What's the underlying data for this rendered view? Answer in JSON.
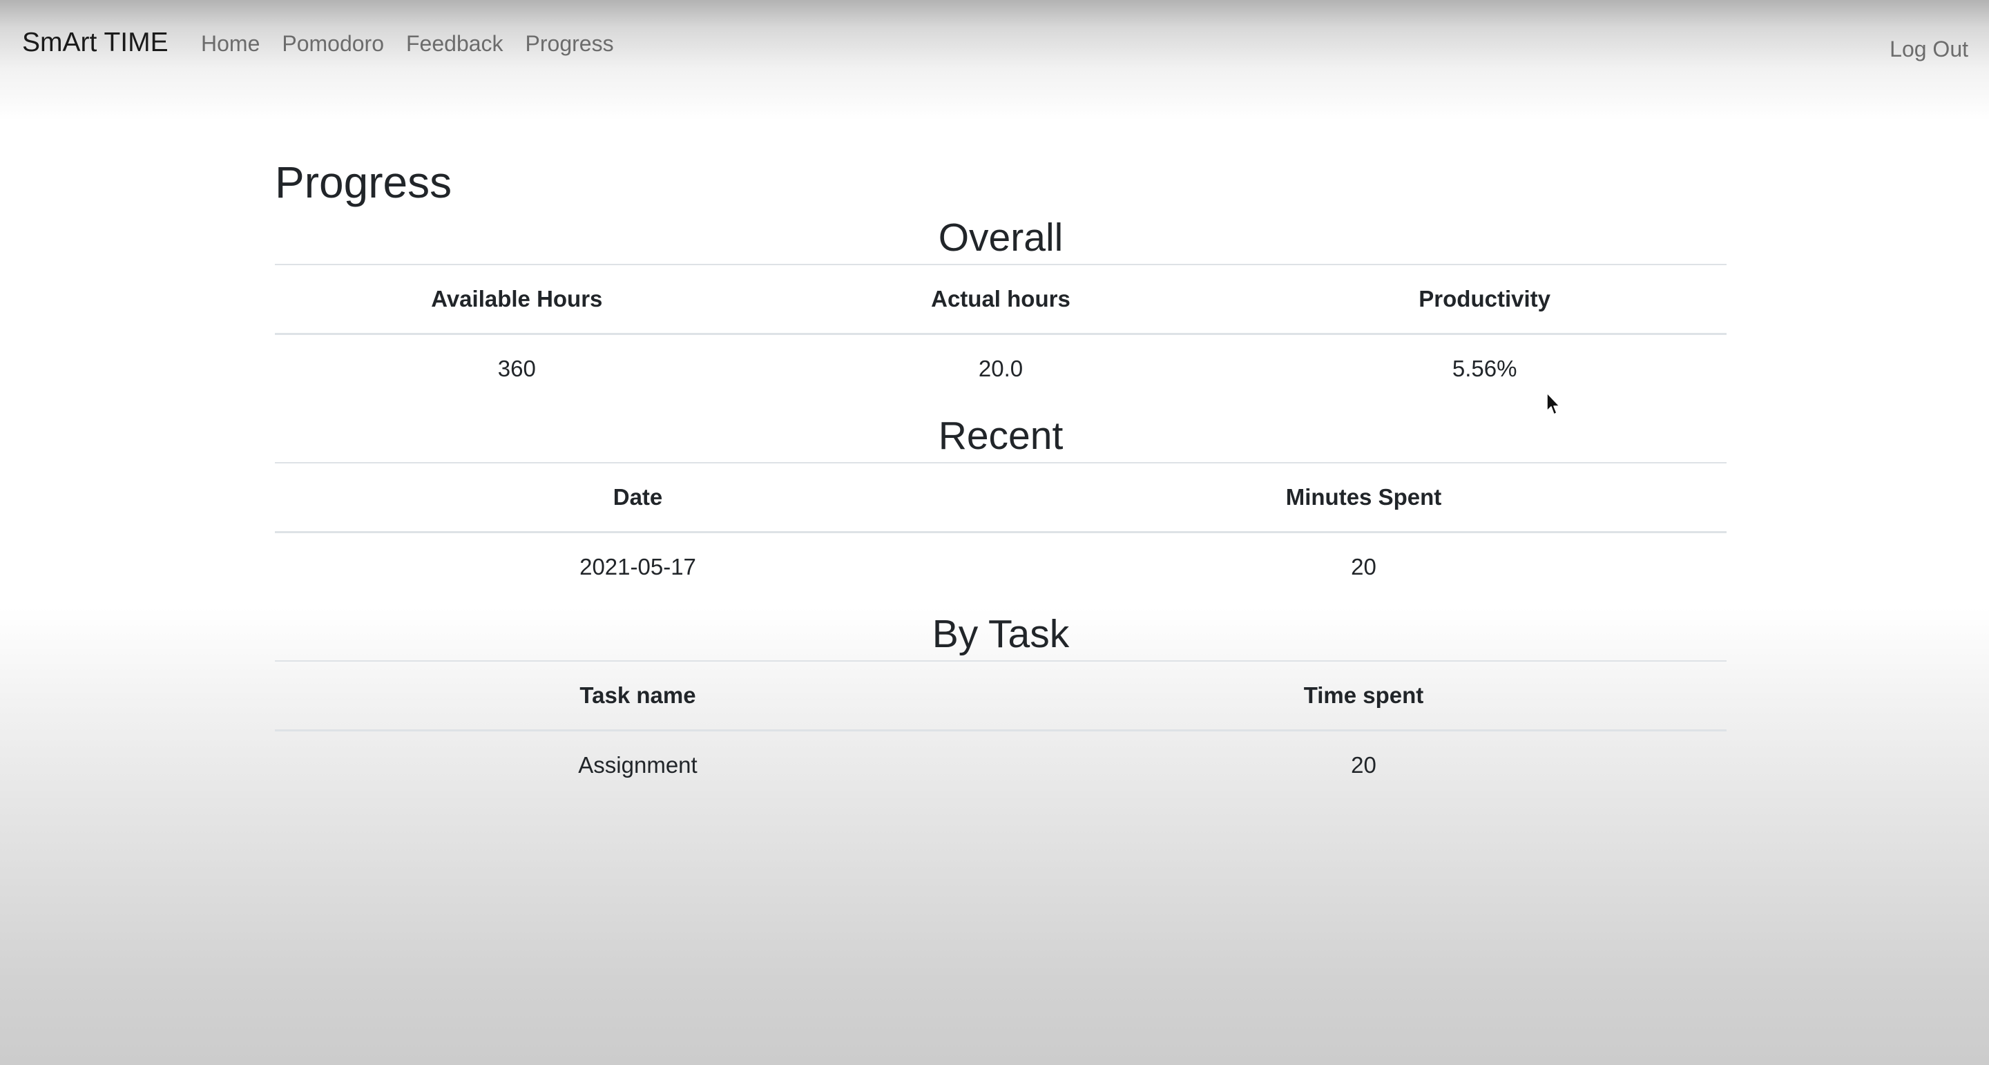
{
  "navbar": {
    "brand": "SmArt TIME",
    "links": [
      {
        "label": "Home"
      },
      {
        "label": "Pomodoro"
      },
      {
        "label": "Feedback"
      },
      {
        "label": "Progress"
      }
    ],
    "logout_label": "Log Out"
  },
  "page": {
    "title": "Progress"
  },
  "overall": {
    "title": "Overall",
    "headers": [
      "Available Hours",
      "Actual hours",
      "Productivity"
    ],
    "rows": [
      [
        "360",
        "20.0",
        "5.56%"
      ]
    ]
  },
  "recent": {
    "title": "Recent",
    "headers": [
      "Date",
      "Minutes Spent"
    ],
    "rows": [
      [
        "2021-05-17",
        "20"
      ]
    ]
  },
  "by_task": {
    "title": "By Task",
    "headers": [
      "Task name",
      "Time spent"
    ],
    "rows": [
      [
        "Assignment",
        "20"
      ]
    ]
  }
}
